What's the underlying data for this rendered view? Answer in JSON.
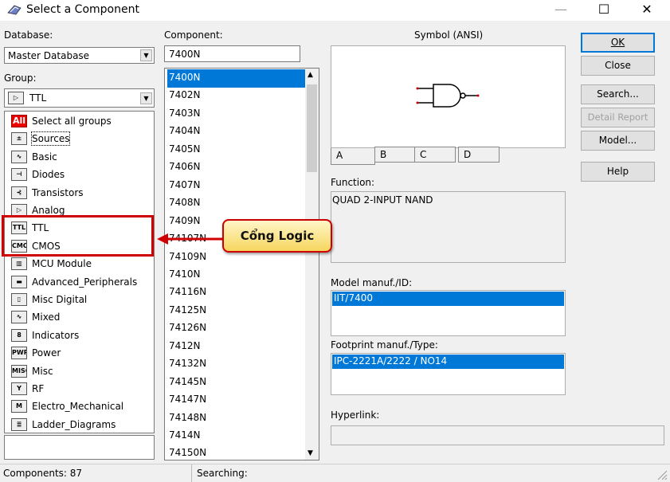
{
  "window": {
    "title": "Select a Component",
    "minimize": "—",
    "maximize": "☐",
    "close": "✕"
  },
  "database": {
    "label": "Database:",
    "value": "Master Database"
  },
  "group": {
    "label": "Group:",
    "value": "TTL",
    "value_icon": "ttl-gate-icon",
    "items": [
      {
        "label": "Select all groups",
        "icon": "all-icon",
        "glyph": "All"
      },
      {
        "label": "Sources",
        "icon": "sources-icon",
        "glyph": "±"
      },
      {
        "label": "Basic",
        "icon": "resistor-icon",
        "glyph": "∿"
      },
      {
        "label": "Diodes",
        "icon": "diode-icon",
        "glyph": "⊣"
      },
      {
        "label": "Transistors",
        "icon": "transistor-icon",
        "glyph": "⊰"
      },
      {
        "label": "Analog",
        "icon": "opamp-icon",
        "glyph": "▷"
      },
      {
        "label": "TTL",
        "icon": "ttl-gate-icon",
        "glyph": "TTL"
      },
      {
        "label": "CMOS",
        "icon": "cmos-gate-icon",
        "glyph": "CMOS"
      },
      {
        "label": "MCU Module",
        "icon": "chip-icon",
        "glyph": "▥"
      },
      {
        "label": "Advanced_Peripherals",
        "icon": "display-icon",
        "glyph": "▬"
      },
      {
        "label": "Misc Digital",
        "icon": "misc-digital-icon",
        "glyph": "▯"
      },
      {
        "label": "Mixed",
        "icon": "mixed-icon",
        "glyph": "∿"
      },
      {
        "label": "Indicators",
        "icon": "indicator-icon",
        "glyph": "8"
      },
      {
        "label": "Power",
        "icon": "power-icon",
        "glyph": "PWR"
      },
      {
        "label": "Misc",
        "icon": "misc-icon",
        "glyph": "MISC"
      },
      {
        "label": "RF",
        "icon": "antenna-icon",
        "glyph": "Y"
      },
      {
        "label": "Electro_Mechanical",
        "icon": "motor-icon",
        "glyph": "M"
      },
      {
        "label": "Ladder_Diagrams",
        "icon": "ladder-icon",
        "glyph": "≣"
      }
    ]
  },
  "component": {
    "label": "Component:",
    "value": "7400N",
    "items": [
      "7400N",
      "7402N",
      "7403N",
      "7404N",
      "7405N",
      "7406N",
      "7407N",
      "7408N",
      "7409N",
      "74107N",
      "74109N",
      "7410N",
      "74116N",
      "74125N",
      "74126N",
      "7412N",
      "74132N",
      "74145N",
      "74147N",
      "74148N",
      "7414N",
      "74150N"
    ]
  },
  "symbol": {
    "label": "Symbol (ANSI)",
    "tabs": [
      "A",
      "B",
      "C",
      "D"
    ]
  },
  "function": {
    "label": "Function:",
    "value": "QUAD 2-INPUT NAND"
  },
  "model": {
    "label": "Model manuf./ID:",
    "items": [
      "IIT/7400"
    ]
  },
  "footprint": {
    "label": "Footprint manuf./Type:",
    "items": [
      "IPC-2221A/2222 / NO14"
    ]
  },
  "hyperlink": {
    "label": "Hyperlink:",
    "value": ""
  },
  "buttons": {
    "ok": "OK",
    "close": "Close",
    "search": "Search...",
    "detail": "Detail Report",
    "model": "Model...",
    "help": "Help"
  },
  "status": {
    "components": "Components: 87",
    "searching": "Searching:"
  },
  "callout": {
    "text": "Cổng Logic"
  },
  "colors": {
    "selection": "#0078d7",
    "highlight_border": "#d00000",
    "callout_fill": "#f6d65e"
  }
}
